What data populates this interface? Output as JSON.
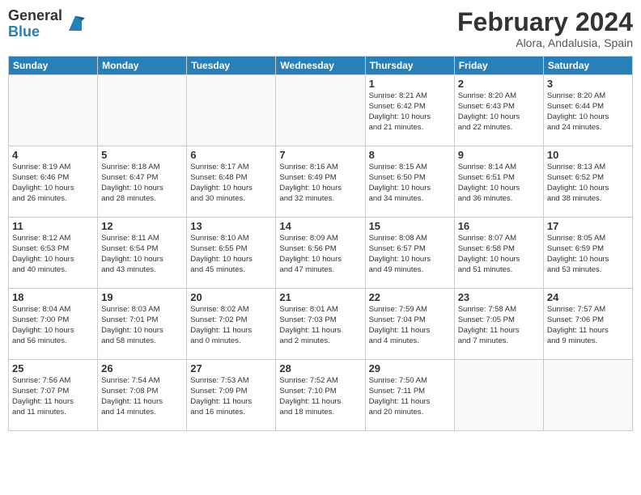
{
  "header": {
    "logo": {
      "general": "General",
      "blue": "Blue"
    },
    "title": "February 2024",
    "location": "Alora, Andalusia, Spain"
  },
  "weekdays": [
    "Sunday",
    "Monday",
    "Tuesday",
    "Wednesday",
    "Thursday",
    "Friday",
    "Saturday"
  ],
  "weeks": [
    [
      {
        "day": "",
        "info": ""
      },
      {
        "day": "",
        "info": ""
      },
      {
        "day": "",
        "info": ""
      },
      {
        "day": "",
        "info": ""
      },
      {
        "day": "1",
        "info": "Sunrise: 8:21 AM\nSunset: 6:42 PM\nDaylight: 10 hours\nand 21 minutes."
      },
      {
        "day": "2",
        "info": "Sunrise: 8:20 AM\nSunset: 6:43 PM\nDaylight: 10 hours\nand 22 minutes."
      },
      {
        "day": "3",
        "info": "Sunrise: 8:20 AM\nSunset: 6:44 PM\nDaylight: 10 hours\nand 24 minutes."
      }
    ],
    [
      {
        "day": "4",
        "info": "Sunrise: 8:19 AM\nSunset: 6:46 PM\nDaylight: 10 hours\nand 26 minutes."
      },
      {
        "day": "5",
        "info": "Sunrise: 8:18 AM\nSunset: 6:47 PM\nDaylight: 10 hours\nand 28 minutes."
      },
      {
        "day": "6",
        "info": "Sunrise: 8:17 AM\nSunset: 6:48 PM\nDaylight: 10 hours\nand 30 minutes."
      },
      {
        "day": "7",
        "info": "Sunrise: 8:16 AM\nSunset: 6:49 PM\nDaylight: 10 hours\nand 32 minutes."
      },
      {
        "day": "8",
        "info": "Sunrise: 8:15 AM\nSunset: 6:50 PM\nDaylight: 10 hours\nand 34 minutes."
      },
      {
        "day": "9",
        "info": "Sunrise: 8:14 AM\nSunset: 6:51 PM\nDaylight: 10 hours\nand 36 minutes."
      },
      {
        "day": "10",
        "info": "Sunrise: 8:13 AM\nSunset: 6:52 PM\nDaylight: 10 hours\nand 38 minutes."
      }
    ],
    [
      {
        "day": "11",
        "info": "Sunrise: 8:12 AM\nSunset: 6:53 PM\nDaylight: 10 hours\nand 40 minutes."
      },
      {
        "day": "12",
        "info": "Sunrise: 8:11 AM\nSunset: 6:54 PM\nDaylight: 10 hours\nand 43 minutes."
      },
      {
        "day": "13",
        "info": "Sunrise: 8:10 AM\nSunset: 6:55 PM\nDaylight: 10 hours\nand 45 minutes."
      },
      {
        "day": "14",
        "info": "Sunrise: 8:09 AM\nSunset: 6:56 PM\nDaylight: 10 hours\nand 47 minutes."
      },
      {
        "day": "15",
        "info": "Sunrise: 8:08 AM\nSunset: 6:57 PM\nDaylight: 10 hours\nand 49 minutes."
      },
      {
        "day": "16",
        "info": "Sunrise: 8:07 AM\nSunset: 6:58 PM\nDaylight: 10 hours\nand 51 minutes."
      },
      {
        "day": "17",
        "info": "Sunrise: 8:05 AM\nSunset: 6:59 PM\nDaylight: 10 hours\nand 53 minutes."
      }
    ],
    [
      {
        "day": "18",
        "info": "Sunrise: 8:04 AM\nSunset: 7:00 PM\nDaylight: 10 hours\nand 56 minutes."
      },
      {
        "day": "19",
        "info": "Sunrise: 8:03 AM\nSunset: 7:01 PM\nDaylight: 10 hours\nand 58 minutes."
      },
      {
        "day": "20",
        "info": "Sunrise: 8:02 AM\nSunset: 7:02 PM\nDaylight: 11 hours\nand 0 minutes."
      },
      {
        "day": "21",
        "info": "Sunrise: 8:01 AM\nSunset: 7:03 PM\nDaylight: 11 hours\nand 2 minutes."
      },
      {
        "day": "22",
        "info": "Sunrise: 7:59 AM\nSunset: 7:04 PM\nDaylight: 11 hours\nand 4 minutes."
      },
      {
        "day": "23",
        "info": "Sunrise: 7:58 AM\nSunset: 7:05 PM\nDaylight: 11 hours\nand 7 minutes."
      },
      {
        "day": "24",
        "info": "Sunrise: 7:57 AM\nSunset: 7:06 PM\nDaylight: 11 hours\nand 9 minutes."
      }
    ],
    [
      {
        "day": "25",
        "info": "Sunrise: 7:56 AM\nSunset: 7:07 PM\nDaylight: 11 hours\nand 11 minutes."
      },
      {
        "day": "26",
        "info": "Sunrise: 7:54 AM\nSunset: 7:08 PM\nDaylight: 11 hours\nand 14 minutes."
      },
      {
        "day": "27",
        "info": "Sunrise: 7:53 AM\nSunset: 7:09 PM\nDaylight: 11 hours\nand 16 minutes."
      },
      {
        "day": "28",
        "info": "Sunrise: 7:52 AM\nSunset: 7:10 PM\nDaylight: 11 hours\nand 18 minutes."
      },
      {
        "day": "29",
        "info": "Sunrise: 7:50 AM\nSunset: 7:11 PM\nDaylight: 11 hours\nand 20 minutes."
      },
      {
        "day": "",
        "info": ""
      },
      {
        "day": "",
        "info": ""
      }
    ]
  ]
}
